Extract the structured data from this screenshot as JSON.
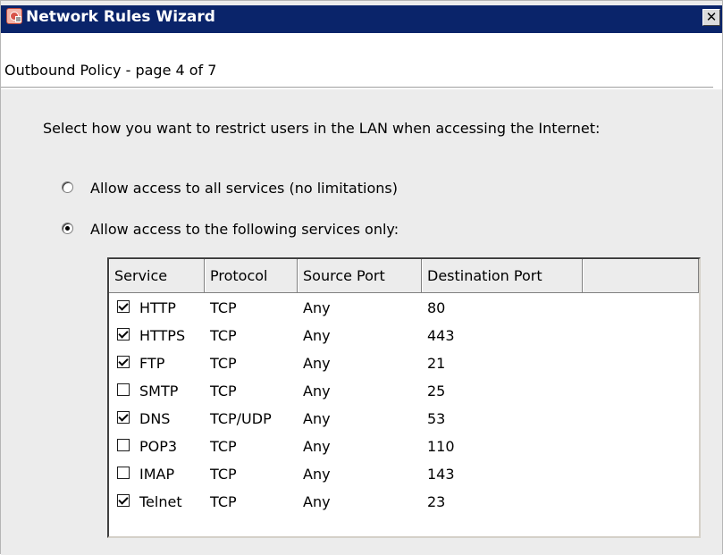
{
  "window": {
    "title": "Network Rules Wizard",
    "close_label": "✕"
  },
  "page": {
    "subtitle": "Outbound Policy - page 4 of 7",
    "instruction": "Select how you want to restrict users in the LAN when accessing the Internet:"
  },
  "options": [
    {
      "label": "Allow access to all services (no limitations)",
      "selected": false
    },
    {
      "label": "Allow access to the following services only:",
      "selected": true
    }
  ],
  "table": {
    "columns": [
      "Service",
      "Protocol",
      "Source Port",
      "Destination Port"
    ],
    "rows": [
      {
        "checked": true,
        "service": "HTTP",
        "protocol": "TCP",
        "source": "Any",
        "dest": "80"
      },
      {
        "checked": true,
        "service": "HTTPS",
        "protocol": "TCP",
        "source": "Any",
        "dest": "443"
      },
      {
        "checked": true,
        "service": "FTP",
        "protocol": "TCP",
        "source": "Any",
        "dest": "21"
      },
      {
        "checked": false,
        "service": "SMTP",
        "protocol": "TCP",
        "source": "Any",
        "dest": "25"
      },
      {
        "checked": true,
        "service": "DNS",
        "protocol": "TCP/UDP",
        "source": "Any",
        "dest": "53"
      },
      {
        "checked": false,
        "service": "POP3",
        "protocol": "TCP",
        "source": "Any",
        "dest": "110"
      },
      {
        "checked": false,
        "service": "IMAP",
        "protocol": "TCP",
        "source": "Any",
        "dest": "143"
      },
      {
        "checked": true,
        "service": "Telnet",
        "protocol": "TCP",
        "source": "Any",
        "dest": "23"
      }
    ]
  },
  "colors": {
    "titlebar": "#0a246a",
    "dialog_bg": "#ececec"
  }
}
